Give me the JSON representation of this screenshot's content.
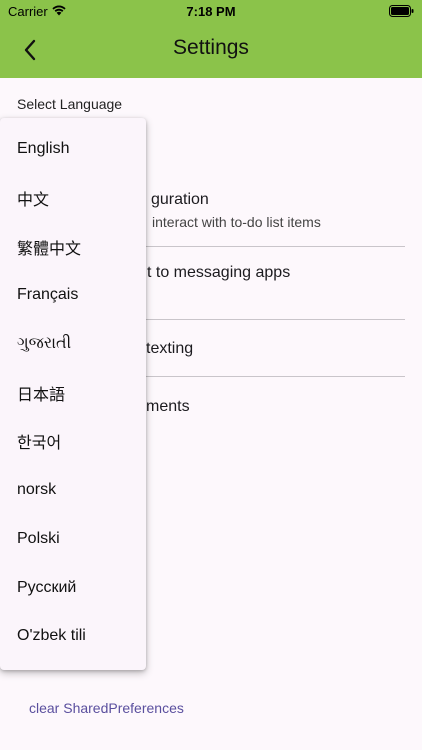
{
  "status_bar": {
    "carrier": "Carrier",
    "time": "7:18 PM",
    "icons": [
      "wifi-icon",
      "battery-icon"
    ]
  },
  "app_bar": {
    "title": "Settings",
    "back_icon": "chevron-left-icon",
    "color": "#8bc34a"
  },
  "section": {
    "label": "Select Language"
  },
  "settings_items": [
    {
      "title": "guration",
      "subtitle": "interact with to-do list items"
    },
    {
      "title": "t to messaging apps",
      "subtitle": ""
    },
    {
      "title": "texting",
      "subtitle": ""
    },
    {
      "title": "ments",
      "subtitle": ""
    }
  ],
  "footer": {
    "link": "clear SharedPreferences"
  },
  "language_dropdown": {
    "options": [
      "English",
      "中文",
      "繁體中文",
      "Français",
      "ગુજરાતી",
      "日本語",
      "한국어",
      "norsk",
      "Polski",
      "Русский",
      "O'zbek tili"
    ]
  }
}
